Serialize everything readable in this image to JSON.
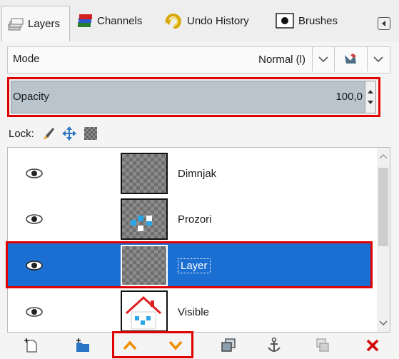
{
  "tabs": [
    {
      "label": "Layers",
      "icon": "layers-icon"
    },
    {
      "label": "Channels",
      "icon": "channels-icon"
    },
    {
      "label": "Undo History",
      "icon": "undo-history-icon"
    },
    {
      "label": "Brushes",
      "icon": "brushes-icon"
    }
  ],
  "mode": {
    "label": "Mode",
    "value": "Normal (l)"
  },
  "opacity": {
    "label": "Opacity",
    "value": "100,0"
  },
  "lock": {
    "label": "Lock:"
  },
  "layers": [
    {
      "name": "Dimnjak",
      "visible": true,
      "selected": false
    },
    {
      "name": "Prozori",
      "visible": true,
      "selected": false
    },
    {
      "name": "Layer",
      "visible": true,
      "selected": true
    },
    {
      "name": "Visible",
      "visible": true,
      "selected": false
    }
  ],
  "toolbar": [
    "new-layer-icon",
    "new-layer-group-icon",
    "raise-layer-icon",
    "lower-layer-icon",
    "duplicate-layer-icon",
    "anchor-layer-icon",
    "merge-down-icon",
    "delete-layer-icon"
  ],
  "colors": {
    "selection": "#1c6fd2",
    "highlight": "#e00000",
    "accent": "#f08c00"
  }
}
